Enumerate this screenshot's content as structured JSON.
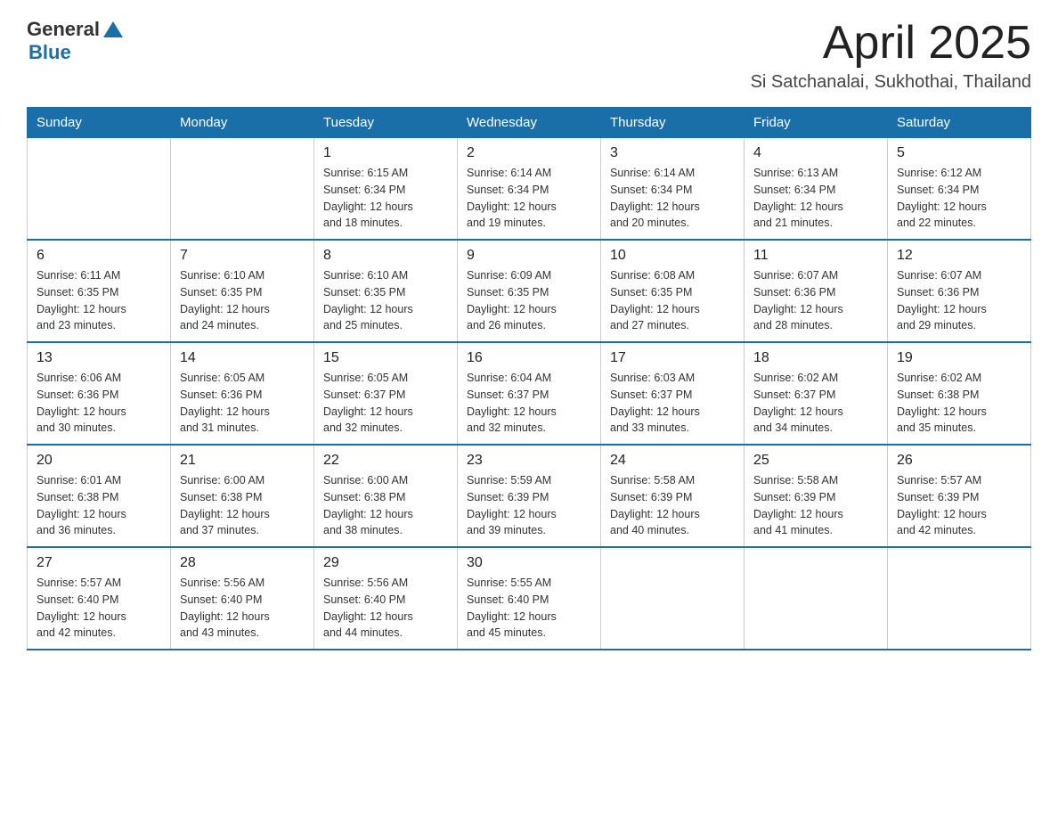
{
  "header": {
    "logo": {
      "text1": "General",
      "text2": "Blue"
    },
    "title": "April 2025",
    "location": "Si Satchanalai, Sukhothai, Thailand"
  },
  "calendar": {
    "days_of_week": [
      "Sunday",
      "Monday",
      "Tuesday",
      "Wednesday",
      "Thursday",
      "Friday",
      "Saturday"
    ],
    "weeks": [
      [
        {
          "day": "",
          "info": ""
        },
        {
          "day": "",
          "info": ""
        },
        {
          "day": "1",
          "info": "Sunrise: 6:15 AM\nSunset: 6:34 PM\nDaylight: 12 hours\nand 18 minutes."
        },
        {
          "day": "2",
          "info": "Sunrise: 6:14 AM\nSunset: 6:34 PM\nDaylight: 12 hours\nand 19 minutes."
        },
        {
          "day": "3",
          "info": "Sunrise: 6:14 AM\nSunset: 6:34 PM\nDaylight: 12 hours\nand 20 minutes."
        },
        {
          "day": "4",
          "info": "Sunrise: 6:13 AM\nSunset: 6:34 PM\nDaylight: 12 hours\nand 21 minutes."
        },
        {
          "day": "5",
          "info": "Sunrise: 6:12 AM\nSunset: 6:34 PM\nDaylight: 12 hours\nand 22 minutes."
        }
      ],
      [
        {
          "day": "6",
          "info": "Sunrise: 6:11 AM\nSunset: 6:35 PM\nDaylight: 12 hours\nand 23 minutes."
        },
        {
          "day": "7",
          "info": "Sunrise: 6:10 AM\nSunset: 6:35 PM\nDaylight: 12 hours\nand 24 minutes."
        },
        {
          "day": "8",
          "info": "Sunrise: 6:10 AM\nSunset: 6:35 PM\nDaylight: 12 hours\nand 25 minutes."
        },
        {
          "day": "9",
          "info": "Sunrise: 6:09 AM\nSunset: 6:35 PM\nDaylight: 12 hours\nand 26 minutes."
        },
        {
          "day": "10",
          "info": "Sunrise: 6:08 AM\nSunset: 6:35 PM\nDaylight: 12 hours\nand 27 minutes."
        },
        {
          "day": "11",
          "info": "Sunrise: 6:07 AM\nSunset: 6:36 PM\nDaylight: 12 hours\nand 28 minutes."
        },
        {
          "day": "12",
          "info": "Sunrise: 6:07 AM\nSunset: 6:36 PM\nDaylight: 12 hours\nand 29 minutes."
        }
      ],
      [
        {
          "day": "13",
          "info": "Sunrise: 6:06 AM\nSunset: 6:36 PM\nDaylight: 12 hours\nand 30 minutes."
        },
        {
          "day": "14",
          "info": "Sunrise: 6:05 AM\nSunset: 6:36 PM\nDaylight: 12 hours\nand 31 minutes."
        },
        {
          "day": "15",
          "info": "Sunrise: 6:05 AM\nSunset: 6:37 PM\nDaylight: 12 hours\nand 32 minutes."
        },
        {
          "day": "16",
          "info": "Sunrise: 6:04 AM\nSunset: 6:37 PM\nDaylight: 12 hours\nand 32 minutes."
        },
        {
          "day": "17",
          "info": "Sunrise: 6:03 AM\nSunset: 6:37 PM\nDaylight: 12 hours\nand 33 minutes."
        },
        {
          "day": "18",
          "info": "Sunrise: 6:02 AM\nSunset: 6:37 PM\nDaylight: 12 hours\nand 34 minutes."
        },
        {
          "day": "19",
          "info": "Sunrise: 6:02 AM\nSunset: 6:38 PM\nDaylight: 12 hours\nand 35 minutes."
        }
      ],
      [
        {
          "day": "20",
          "info": "Sunrise: 6:01 AM\nSunset: 6:38 PM\nDaylight: 12 hours\nand 36 minutes."
        },
        {
          "day": "21",
          "info": "Sunrise: 6:00 AM\nSunset: 6:38 PM\nDaylight: 12 hours\nand 37 minutes."
        },
        {
          "day": "22",
          "info": "Sunrise: 6:00 AM\nSunset: 6:38 PM\nDaylight: 12 hours\nand 38 minutes."
        },
        {
          "day": "23",
          "info": "Sunrise: 5:59 AM\nSunset: 6:39 PM\nDaylight: 12 hours\nand 39 minutes."
        },
        {
          "day": "24",
          "info": "Sunrise: 5:58 AM\nSunset: 6:39 PM\nDaylight: 12 hours\nand 40 minutes."
        },
        {
          "day": "25",
          "info": "Sunrise: 5:58 AM\nSunset: 6:39 PM\nDaylight: 12 hours\nand 41 minutes."
        },
        {
          "day": "26",
          "info": "Sunrise: 5:57 AM\nSunset: 6:39 PM\nDaylight: 12 hours\nand 42 minutes."
        }
      ],
      [
        {
          "day": "27",
          "info": "Sunrise: 5:57 AM\nSunset: 6:40 PM\nDaylight: 12 hours\nand 42 minutes."
        },
        {
          "day": "28",
          "info": "Sunrise: 5:56 AM\nSunset: 6:40 PM\nDaylight: 12 hours\nand 43 minutes."
        },
        {
          "day": "29",
          "info": "Sunrise: 5:56 AM\nSunset: 6:40 PM\nDaylight: 12 hours\nand 44 minutes."
        },
        {
          "day": "30",
          "info": "Sunrise: 5:55 AM\nSunset: 6:40 PM\nDaylight: 12 hours\nand 45 minutes."
        },
        {
          "day": "",
          "info": ""
        },
        {
          "day": "",
          "info": ""
        },
        {
          "day": "",
          "info": ""
        }
      ]
    ]
  }
}
